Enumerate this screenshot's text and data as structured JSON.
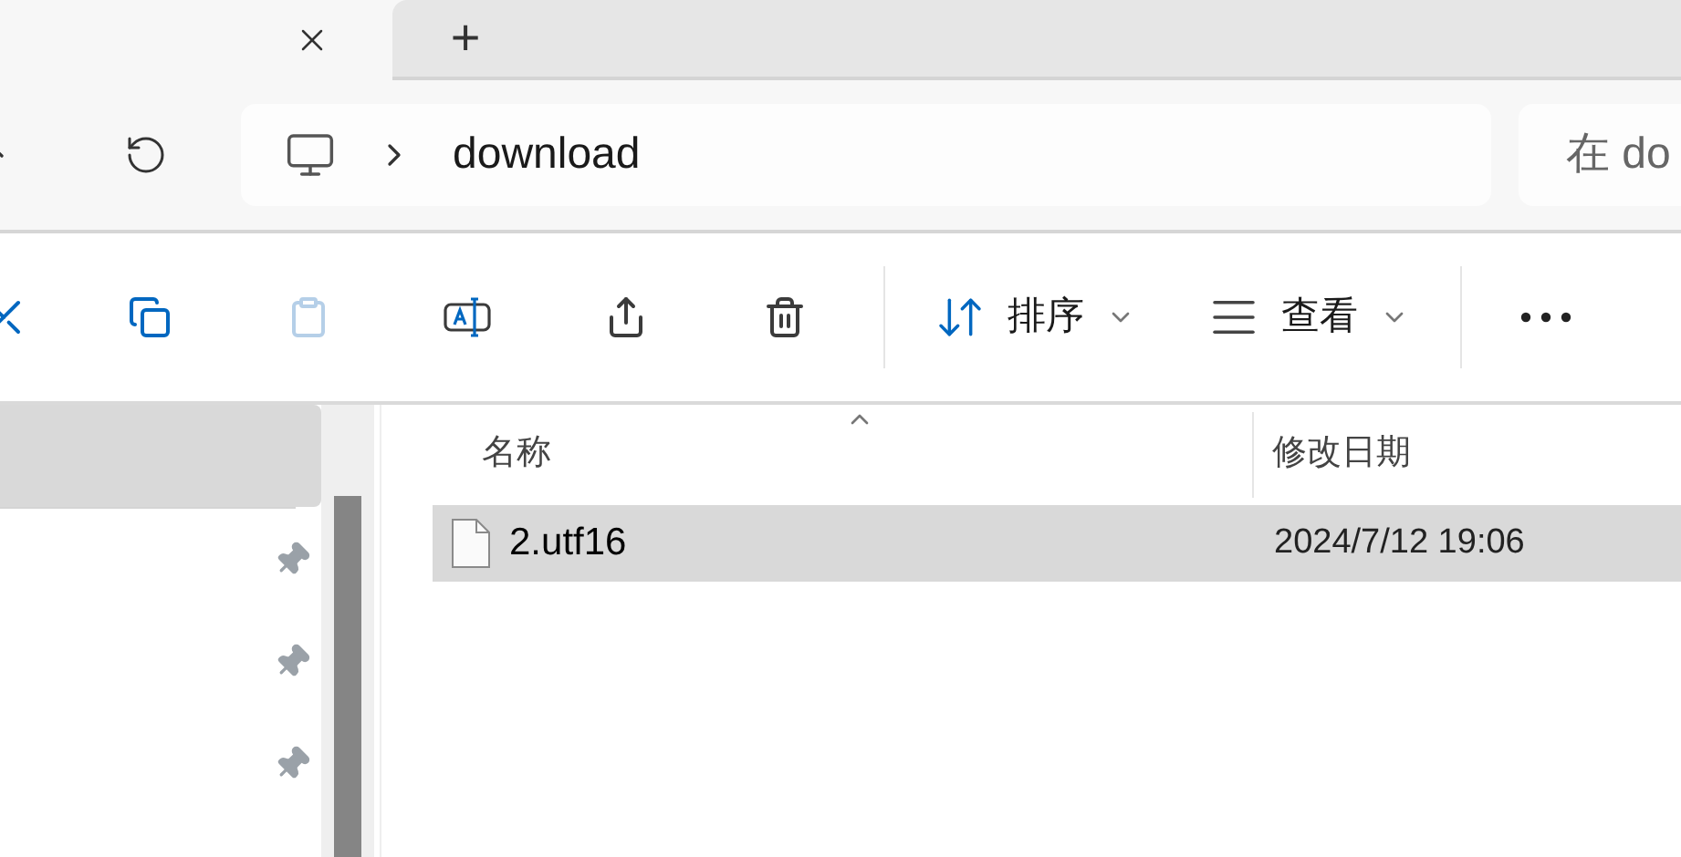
{
  "tab_strip": {
    "new_tab_label": "+"
  },
  "address_bar": {
    "path": [
      "download"
    ]
  },
  "search": {
    "placeholder": "在 do"
  },
  "toolbar": {
    "items": [
      {
        "kind": "cut",
        "disabled": false
      },
      {
        "kind": "copy",
        "disabled": false
      },
      {
        "kind": "paste",
        "disabled": true
      },
      {
        "kind": "rename",
        "disabled": false
      },
      {
        "kind": "share",
        "disabled": false
      },
      {
        "kind": "delete",
        "disabled": false
      }
    ],
    "sort": {
      "label": "排序"
    },
    "view": {
      "label": "查看"
    }
  },
  "sidebar": {
    "items": [
      {
        "selected": true,
        "pinned": false
      },
      {
        "selected": false,
        "pinned": true
      },
      {
        "selected": false,
        "pinned": true
      },
      {
        "selected": false,
        "pinned": true
      }
    ]
  },
  "file_list": {
    "columns": [
      {
        "label": "名称",
        "sorted": true
      },
      {
        "label": "修改日期",
        "sorted": false
      }
    ],
    "rows": [
      {
        "name": "2.utf16",
        "modified": "2024/7/12 19:06",
        "selected": true
      }
    ]
  }
}
